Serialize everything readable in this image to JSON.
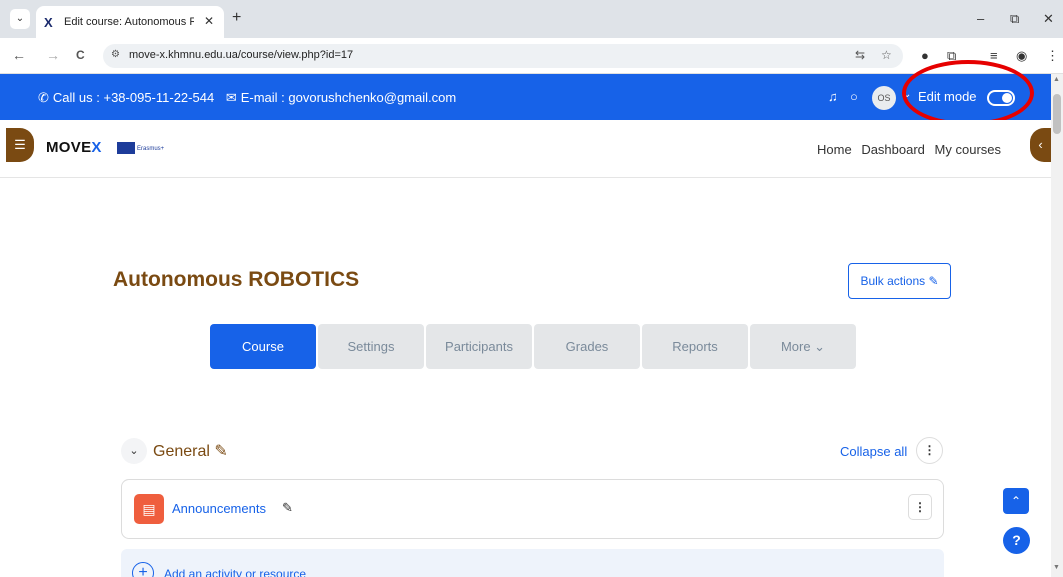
{
  "browser": {
    "tab_list_icon": "chevron-down-icon",
    "tab": {
      "favicon": "X",
      "title": "Edit course: Autonomous ROBOTICS",
      "close": "✕"
    },
    "new_tab": "+",
    "window_controls": {
      "minimize": "–",
      "restore": "⧉",
      "close": "✕"
    },
    "nav": {
      "back": "←",
      "forward": "→",
      "reload": "C"
    },
    "omnibox": {
      "site_info_icon": "tune-icon",
      "url": "move-x.khmnu.edu.ua/course/view.php?id=17"
    }
  },
  "site_bar": {
    "phone_label": "Call us : +38-095-11-22-544",
    "email_label": "E-mail : govorushchenko@gmail.com",
    "avatar_initials": "OS",
    "edit_mode_label": "Edit mode",
    "edit_mode_on": true
  },
  "navbar": {
    "logo_text": "MOVE",
    "logo_accent": "X",
    "erasmus": "Erasmus+",
    "links": {
      "home": "Home",
      "dashboard": "Dashboard",
      "my_courses": "My courses"
    }
  },
  "course": {
    "title": "Autonomous ROBOTICS",
    "bulk_actions": "Bulk actions",
    "tabs": [
      {
        "label": "Course",
        "active": true
      },
      {
        "label": "Settings"
      },
      {
        "label": "Participants"
      },
      {
        "label": "Grades"
      },
      {
        "label": "Reports"
      },
      {
        "label": "More ⌄"
      }
    ],
    "section": {
      "name": "General",
      "collapse_all": "Collapse all"
    },
    "activity": {
      "name": "Announcements",
      "type_icon": "forum-icon"
    },
    "add_activity": "Add an activity or resource"
  },
  "colors": {
    "primary": "#1762e8",
    "brand_brown": "#7a4a12",
    "forum": "#ef5e3e",
    "annotation_ring": "#e60000"
  }
}
